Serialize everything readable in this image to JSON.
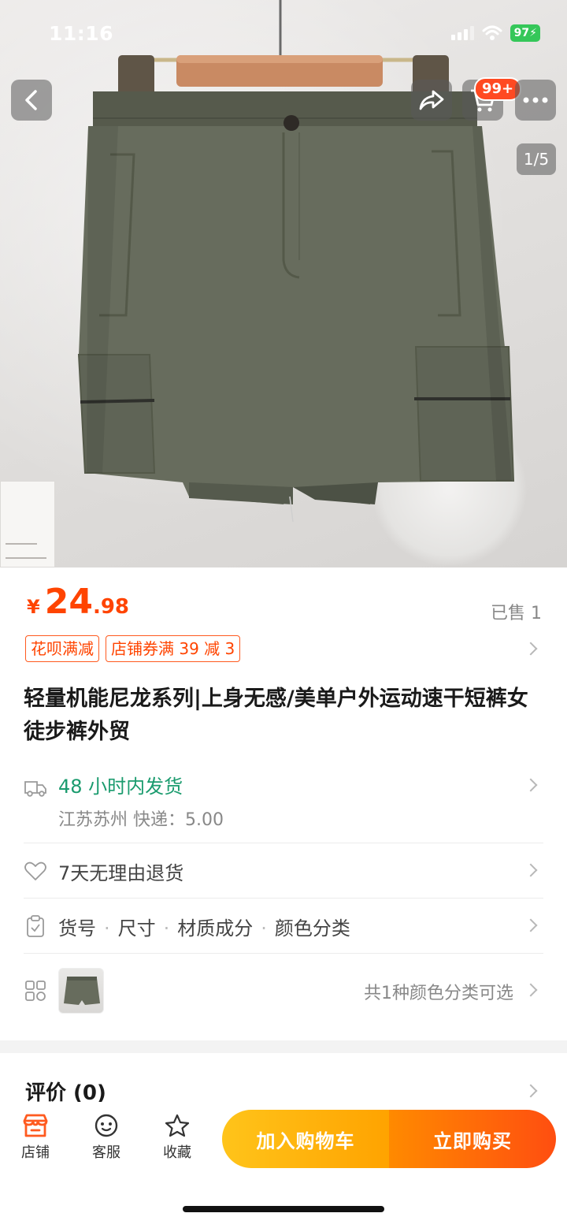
{
  "status": {
    "time": "11:16",
    "battery": "97"
  },
  "nav": {
    "cart_badge": "99+",
    "page_indicator": "1/5"
  },
  "price": {
    "currency": "¥",
    "integer": "24",
    "decimal": ".98",
    "sold": "已售 1"
  },
  "promo_tags": [
    "花呗满减",
    "店铺券满 39 减 3"
  ],
  "product_title": "轻量机能尼龙系列|上身无感/美单户外运动速干短裤女徒步裤外贸",
  "shipping": {
    "main": "48 小时内发货",
    "sub": "江苏苏州  快递：5.00"
  },
  "returns": "7天无理由退货",
  "specs": {
    "items": [
      "货号",
      "尺寸",
      "材质成分",
      "颜色分类"
    ]
  },
  "variants": {
    "count_text": "共1种颜色分类可选"
  },
  "reviews": {
    "title": "评价 (0)"
  },
  "bottom": {
    "tabs": [
      {
        "label": "店铺",
        "icon": "store-icon"
      },
      {
        "label": "客服",
        "icon": "service-icon"
      },
      {
        "label": "收藏",
        "icon": "star-icon"
      }
    ],
    "add_to_cart": "加入购物车",
    "buy_now": "立即购买"
  },
  "colors": {
    "accent": "#ff4400",
    "ship_green": "#1a9b6e",
    "cart_btn": "#ffb20a",
    "buy_btn": "#ff6a0a"
  }
}
